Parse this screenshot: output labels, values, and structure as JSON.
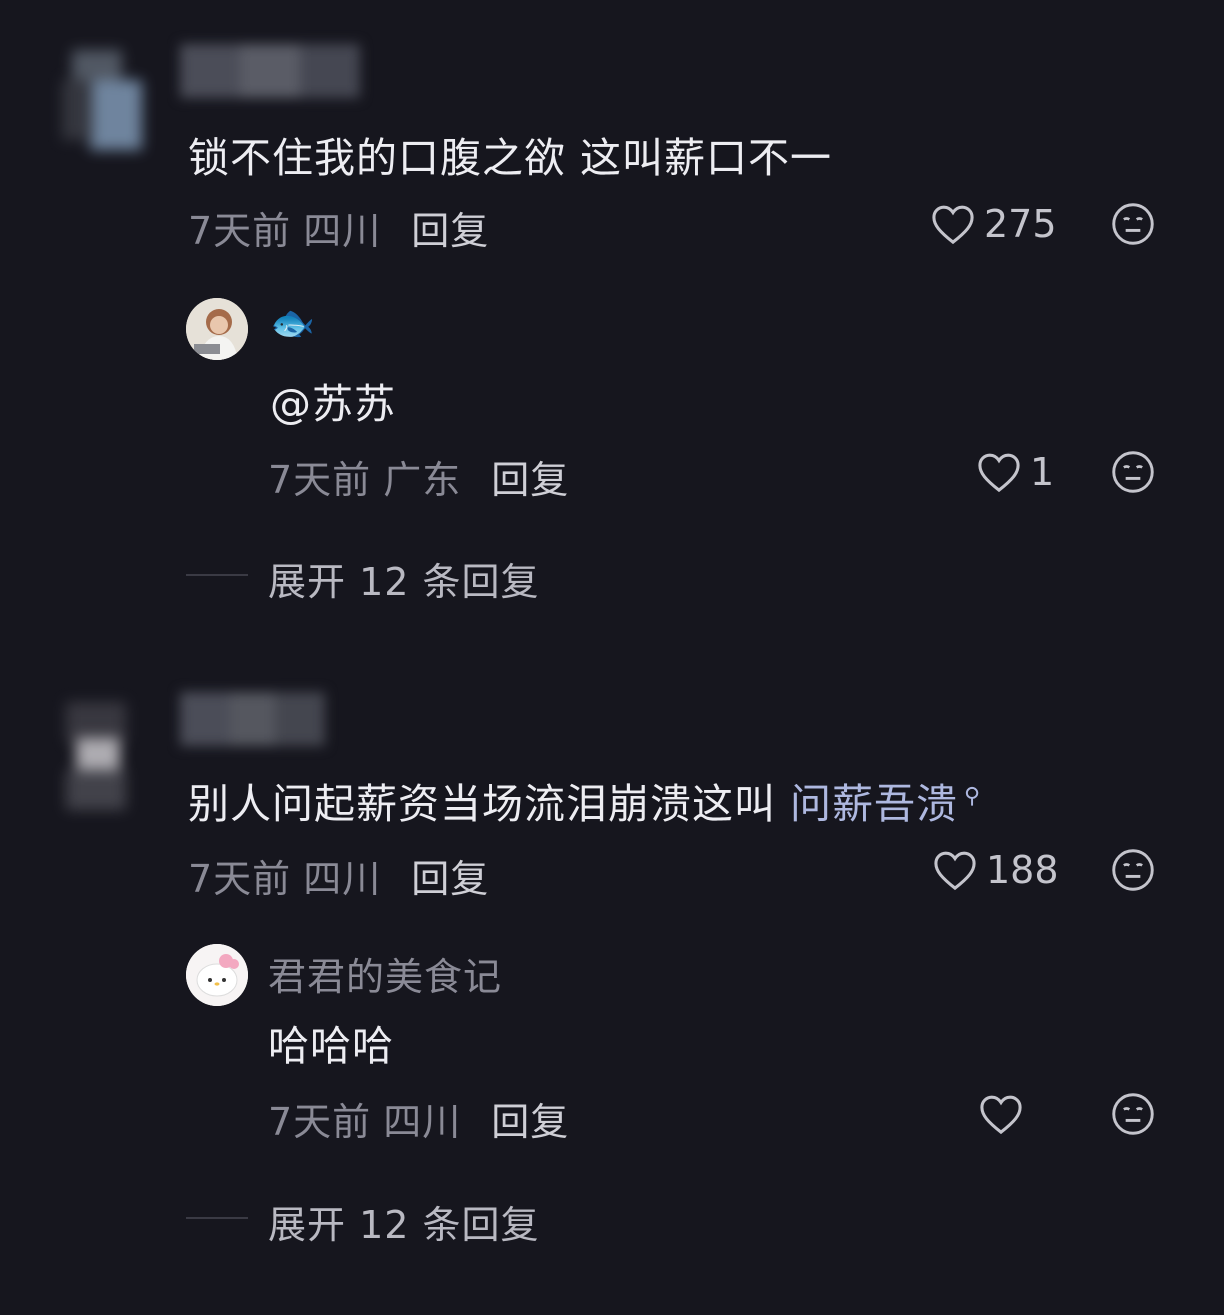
{
  "comments": [
    {
      "text": "锁不住我的口腹之欲  这叫薪口不一",
      "time": "7天前",
      "location": "四川",
      "reply_label": "回复",
      "likes": "275",
      "reply": {
        "username_emoji": "🐟",
        "text": "@苏苏",
        "time": "7天前",
        "location": "广东",
        "reply_label": "回复",
        "likes": "1"
      },
      "expand_label": "展开 12 条回复"
    },
    {
      "text_main": "别人问起薪资当场流泪崩溃这叫 ",
      "text_highlight": "问薪吾溃",
      "time": "7天前",
      "location": "四川",
      "reply_label": "回复",
      "likes": "188",
      "reply": {
        "username": "君君的美食记",
        "text": "哈哈哈",
        "time": "7天前",
        "location": "四川",
        "reply_label": "回复",
        "likes": ""
      },
      "expand_label": "展开 12 条回复"
    }
  ],
  "icons": {
    "like": "heart-outline-icon",
    "more": "emoji-face-icon",
    "search": "search-icon"
  },
  "colors": {
    "background": "#16161e",
    "text": "#ededf2",
    "meta": "#8a8a96",
    "highlight": "#aeb8e0"
  }
}
